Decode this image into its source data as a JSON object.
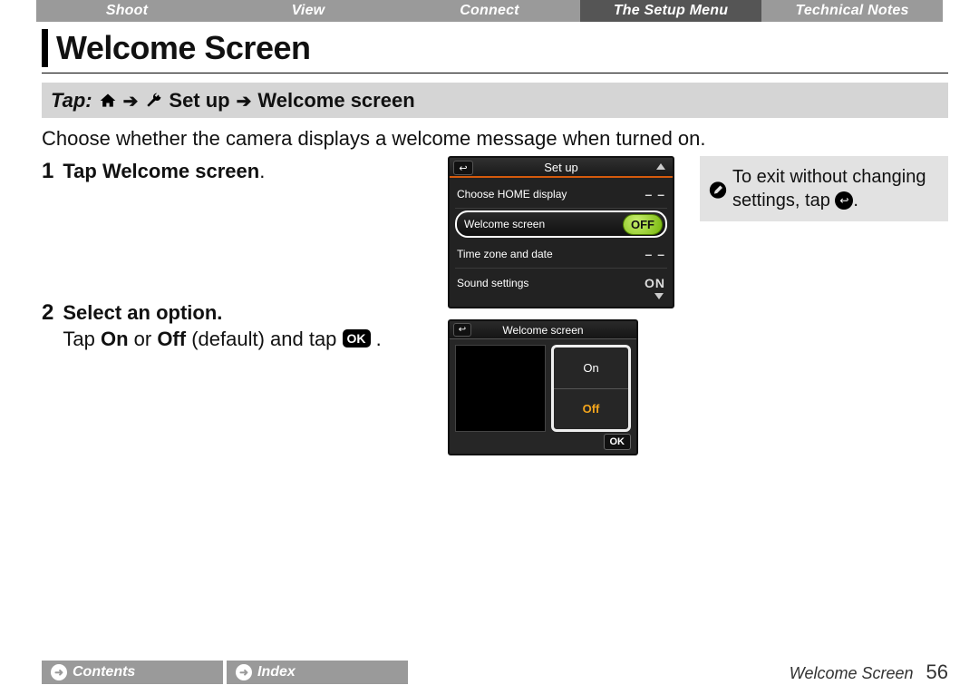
{
  "tabs": {
    "t0": "Shoot",
    "t1": "View",
    "t2": "Connect",
    "t3": "The Setup Menu",
    "t4": "Technical Notes"
  },
  "title": "Welcome Screen",
  "navpath": {
    "tap": "Tap:",
    "setup": "Set up",
    "welcome": "Welcome screen"
  },
  "intro": "Choose whether the camera displays a welcome message when turned on.",
  "steps": {
    "s1": {
      "num": "1",
      "title_a": "Tap ",
      "title_b": "Welcome screen",
      "title_c": "."
    },
    "s2": {
      "num": "2",
      "title": "Select an option.",
      "body_a": "Tap ",
      "body_on": "On",
      "body_b": " or ",
      "body_off": "Off",
      "body_c": " (default) and tap ",
      "ok": "OK",
      "body_d": " ."
    }
  },
  "note": {
    "line1": "To exit without changing",
    "line2a": "settings, tap ",
    "line2b": "."
  },
  "cam1": {
    "title": "Set up",
    "r0": {
      "label": "Choose HOME display",
      "val": "– –"
    },
    "r1": {
      "label": "Welcome screen",
      "val": "OFF"
    },
    "r2": {
      "label": "Time zone and date",
      "val": "– –"
    },
    "r3": {
      "label": "Sound settings",
      "val": "ON"
    }
  },
  "cam2": {
    "title": "Welcome screen",
    "opt_on": "On",
    "opt_off": "Off",
    "ok": "OK"
  },
  "footer": {
    "contents": "Contents",
    "index": "Index",
    "section": "Welcome Screen",
    "page": "56"
  }
}
